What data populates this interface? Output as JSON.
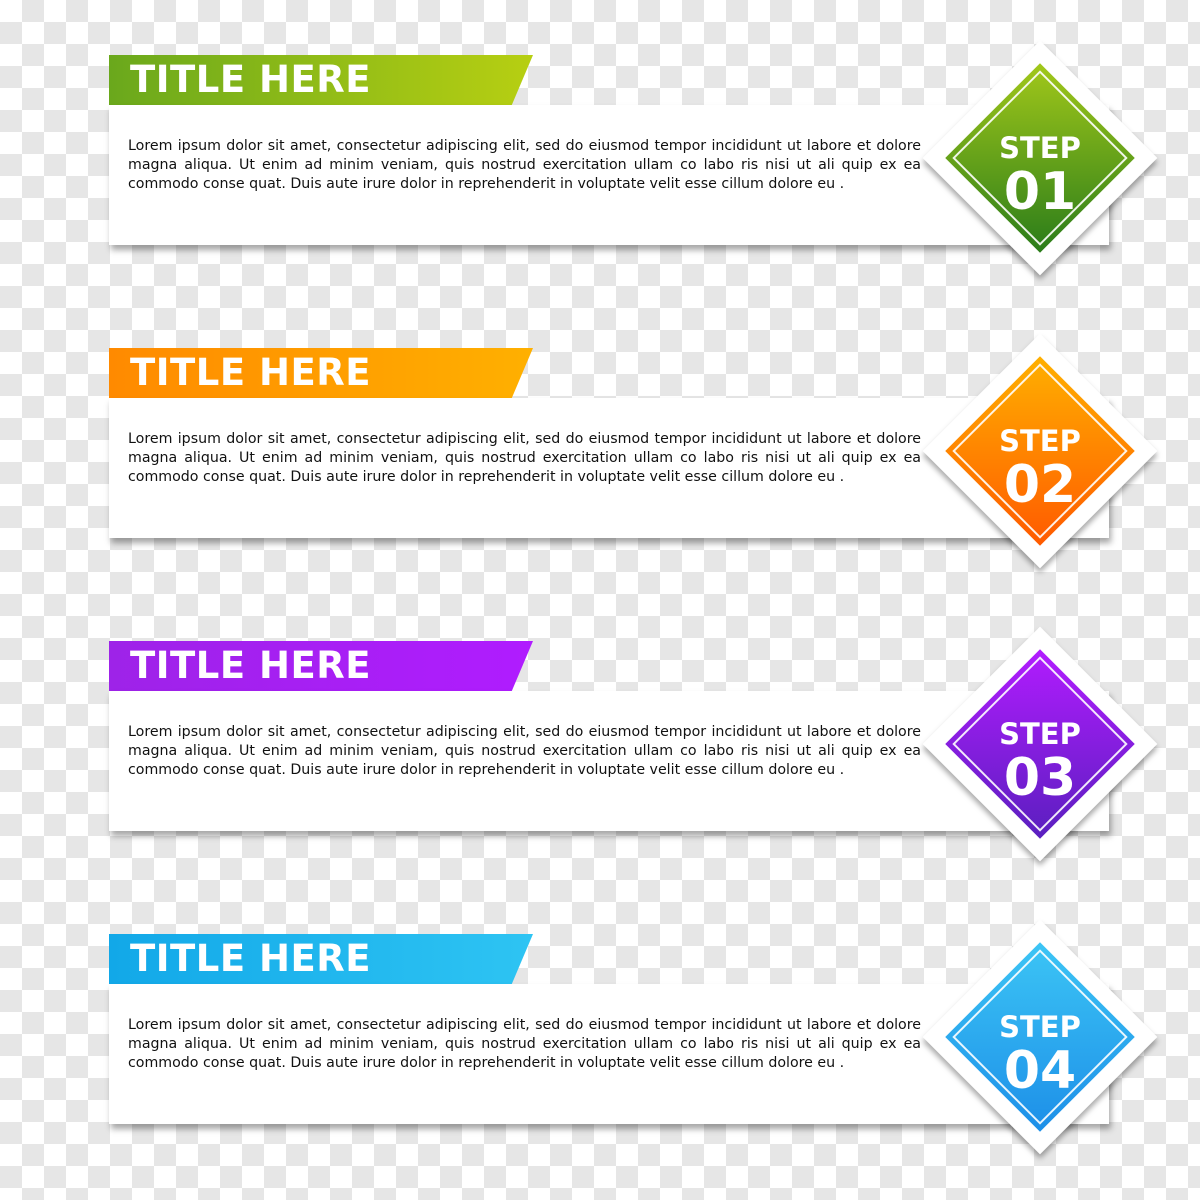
{
  "steps": [
    {
      "title": "TITLE HERE",
      "body": "Lorem ipsum dolor sit amet, consectetur adipiscing elit, sed do eiusmod tempor incididunt ut labore et dolore magna aliqua. Ut enim ad minim veniam, quis nostrud  exercitation ullam co labo ris nisi ut ali quip ex ea commodo conse quat. Duis aute irure dolor in reprehenderit in voluptate velit esse cillum dolore eu .",
      "step_label": "STEP",
      "step_number": "01",
      "color": "#4f9a1c"
    },
    {
      "title": "TITLE HERE",
      "body": "Lorem ipsum dolor sit amet, consectetur adipiscing elit, sed do eiusmod tempor incididunt ut labore et dolore magna aliqua. Ut enim ad minim veniam, quis nostrud  exercitation ullam co labo ris nisi ut ali quip ex ea commodo conse quat. Duis aute irure dolor in reprehenderit in voluptate velit esse cillum dolore eu .",
      "step_label": "STEP",
      "step_number": "02",
      "color": "#ff8a00"
    },
    {
      "title": "TITLE HERE",
      "body": "Lorem ipsum dolor sit amet, consectetur adipiscing elit, sed do eiusmod tempor incididunt ut labore et dolore magna aliqua. Ut enim ad minim veniam, quis nostrud  exercitation ullam co labo ris nisi ut ali quip ex ea commodo conse quat. Duis aute irure dolor in reprehenderit in voluptate velit esse cillum dolore eu .",
      "step_label": "STEP",
      "step_number": "03",
      "color": "#9a22e6"
    },
    {
      "title": "TITLE HERE",
      "body": "Lorem ipsum dolor sit amet, consectetur adipiscing elit, sed do eiusmod tempor incididunt ut labore et dolore magna aliqua. Ut enim ad minim veniam, quis nostrud  exercitation ullam co labo ris nisi ut ali quip ex ea commodo conse quat. Duis aute irure dolor in reprehenderit in voluptate velit esse cillum dolore eu .",
      "step_label": "STEP",
      "step_number": "04",
      "color": "#1aa6ec"
    }
  ]
}
